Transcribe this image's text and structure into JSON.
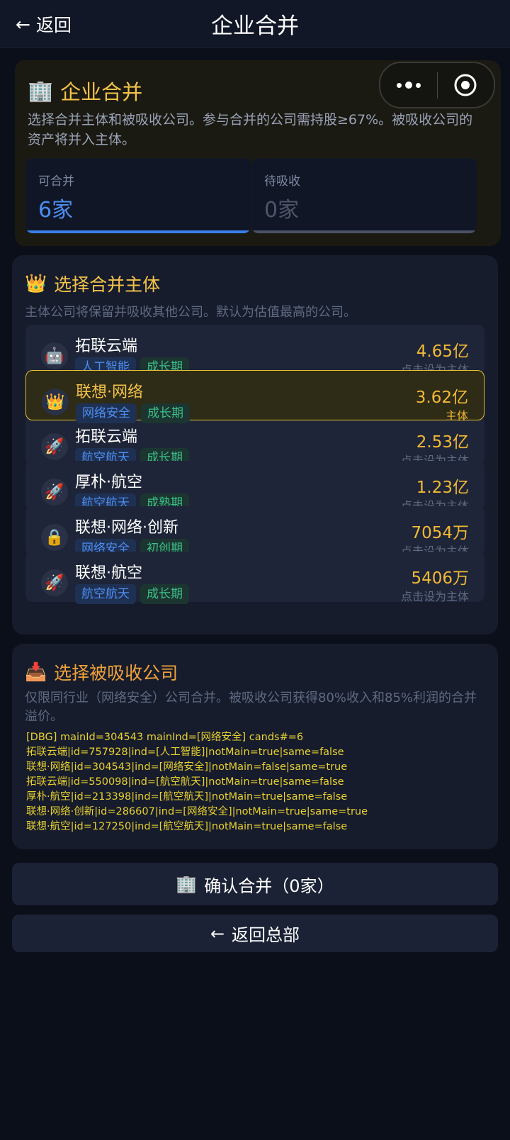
{
  "topbar": {
    "back_label": "返回",
    "title": "企业合并"
  },
  "header": {
    "title": "企业合并",
    "description": "选择合并主体和被吸收公司。参与合并的公司需持股≥67%。被吸收公司的资产将并入主体。",
    "stats": [
      {
        "label": "可合并",
        "value": "6家",
        "color": "#4d8df0",
        "bar_color": "#3a7ee8"
      },
      {
        "label": "待吸收",
        "value": "0家",
        "color": "#4e5568",
        "bar_color": "#4a5266"
      }
    ]
  },
  "main_section": {
    "title": "选择合并主体",
    "description": "主体公司将保留并吸收其他公司。默认为估值最高的公司。",
    "companies": [
      {
        "name": "拓联云端",
        "icon": "robot-icon",
        "industry": "人工智能",
        "stage": "成长期",
        "value": "4.65亿",
        "action": "点击设为主体",
        "selected": false
      },
      {
        "name": "联想·网络",
        "icon": "crown-icon",
        "industry": "网络安全",
        "stage": "成长期",
        "value": "3.62亿",
        "action": "主体",
        "selected": true
      },
      {
        "name": "拓联云端",
        "icon": "rocket-icon",
        "industry": "航空航天",
        "stage": "成长期",
        "value": "2.53亿",
        "action": "点击设为主体",
        "selected": false
      },
      {
        "name": "厚朴·航空",
        "icon": "rocket-icon",
        "industry": "航空航天",
        "stage": "成熟期",
        "value": "1.23亿",
        "action": "点击设为主体",
        "selected": false
      },
      {
        "name": "联想·网络·创新",
        "icon": "lock-icon",
        "industry": "网络安全",
        "stage": "初创期",
        "value": "7054万",
        "action": "点击设为主体",
        "selected": false
      },
      {
        "name": "联想·航空",
        "icon": "rocket-icon",
        "industry": "航空航天",
        "stage": "成长期",
        "value": "5406万",
        "action": "点击设为主体",
        "selected": false
      }
    ]
  },
  "absorb_section": {
    "title": "选择被吸收公司",
    "description": "仅限同行业（网络安全）公司合并。被吸收公司获得80%收入和85%利润的合并溢价。",
    "debug_lines": [
      "[DBG] mainId=304543 mainInd=[网络安全] cands#=6",
      "拓联云端|id=757928|ind=[人工智能]|notMain=true|same=false",
      "联想·网络|id=304543|ind=[网络安全]|notMain=false|same=true",
      "拓联云端|id=550098|ind=[航空航天]|notMain=true|same=false",
      "厚朴·航空|id=213398|ind=[航空航天]|notMain=true|same=false",
      "联想·网络·创新|id=286607|ind=[网络安全]|notMain=true|same=true",
      "联想·航空|id=127250|ind=[航空航天]|notMain=true|same=false"
    ]
  },
  "buttons": {
    "confirm_label": "确认合并（0家）",
    "back_label": "返回总部"
  },
  "colors": {
    "accent_gold": "#f3c24a",
    "accent_blue": "#4d8df0",
    "background": "#0b0f19"
  }
}
